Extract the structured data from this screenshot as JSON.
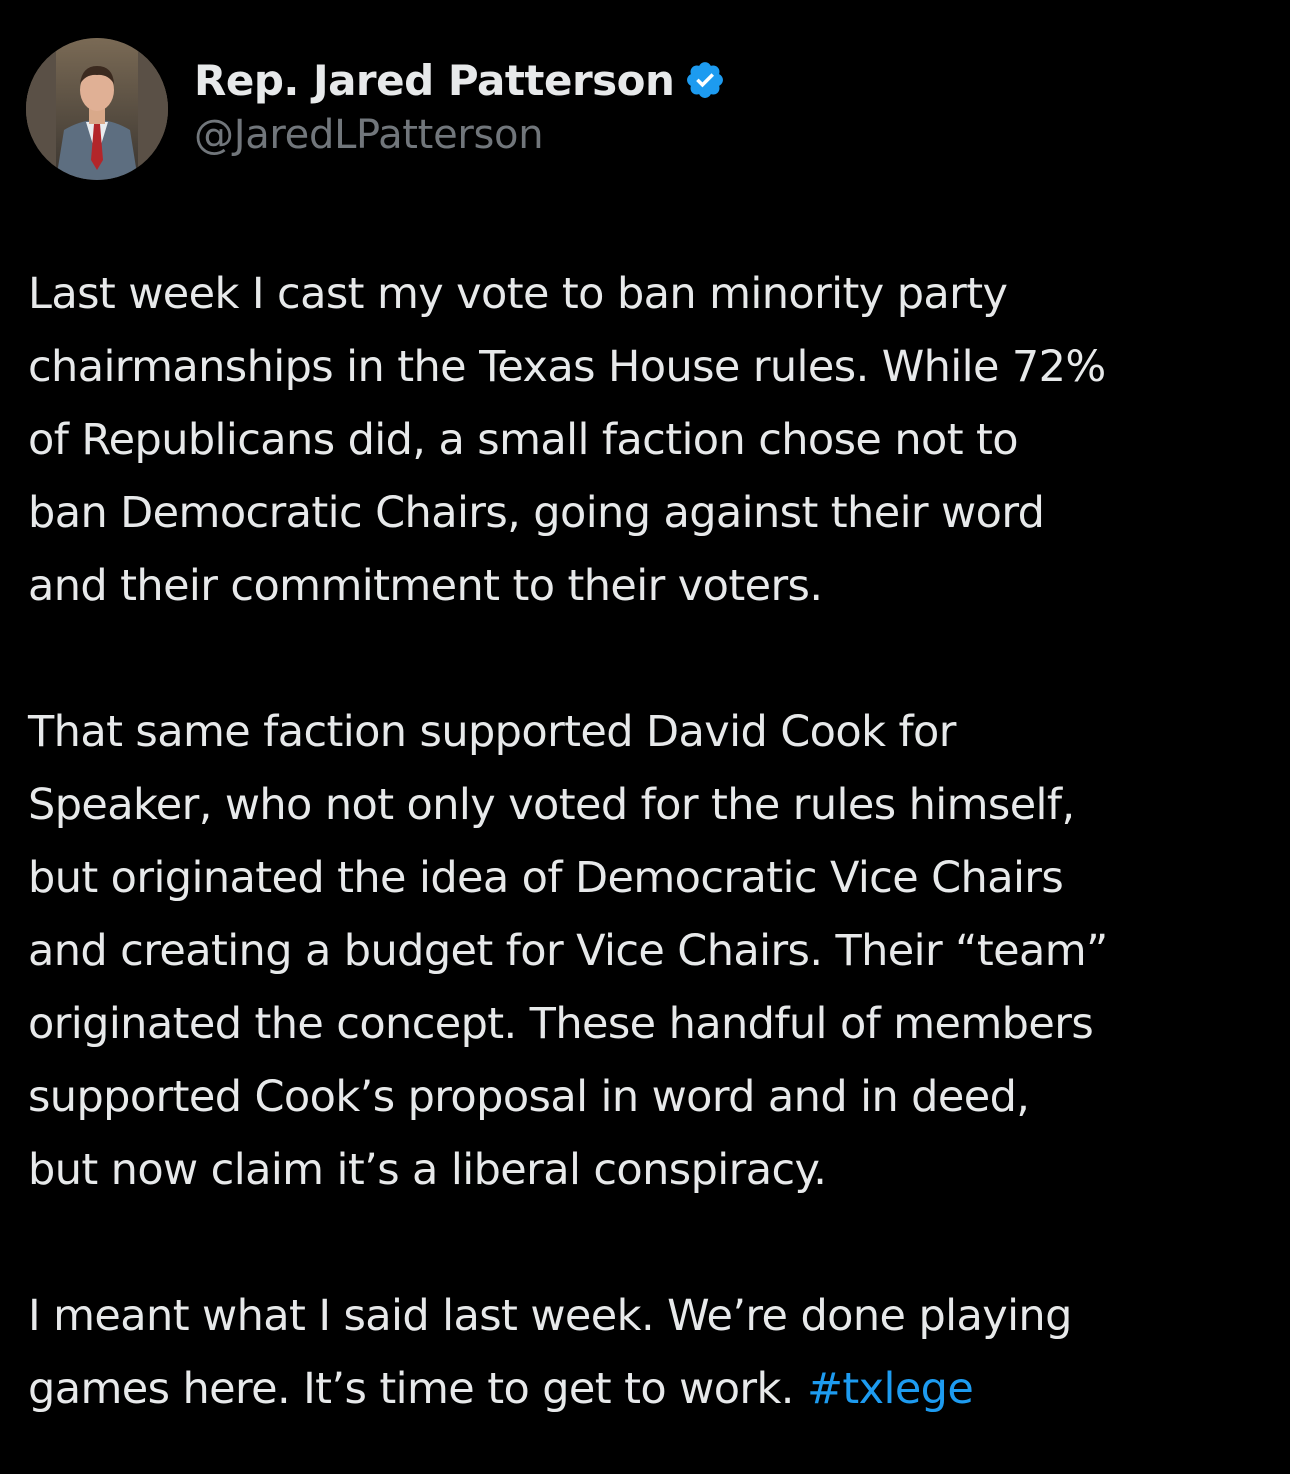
{
  "author": {
    "display_name": "Rep. Jared Patterson",
    "handle": "@JaredLPatterson",
    "verified_icon": "verified-badge-icon",
    "verified_color": "#1d9bf0"
  },
  "tweet": {
    "paragraphs": [
      [
        "Last week I cast my vote to ban minority party",
        "chairmanships in the Texas House rules. While 72%",
        "of Republicans did, a small faction chose not to",
        "ban Democratic Chairs, going against their word",
        "and their commitment to their voters."
      ],
      [
        "That same faction supported David Cook for",
        "Speaker, who not only voted for the rules himself,",
        "but originated the idea of Democratic Vice Chairs",
        "and creating a budget for Vice Chairs. Their “team”",
        "originated the concept. These handful of members",
        "supported Cook’s proposal in word and in deed,",
        "but now claim it’s a liberal conspiracy."
      ],
      [
        "I meant what I said last week. We’re done playing"
      ]
    ],
    "last_line_text": "games here. It’s time to get to work. ",
    "hashtag": "#txlege",
    "hashtag_color": "#1d9bf0"
  },
  "colors": {
    "background": "#000000",
    "primary_text": "#e7e9ea",
    "secondary_text": "#71767b"
  }
}
